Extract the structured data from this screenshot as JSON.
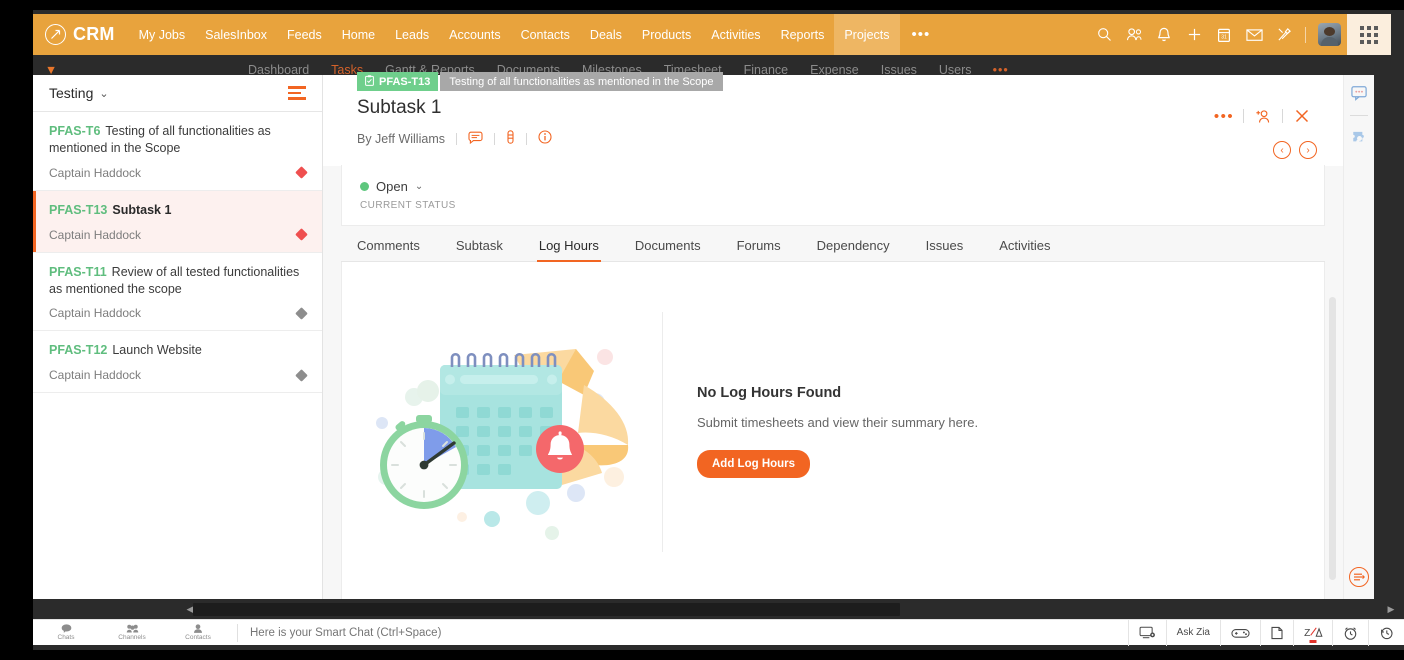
{
  "topnav": {
    "brand": "CRM",
    "brand_icon": "zoho-circle-icon",
    "items": [
      {
        "label": "My Jobs",
        "active": false
      },
      {
        "label": "SalesInbox",
        "active": false
      },
      {
        "label": "Feeds",
        "active": false
      },
      {
        "label": "Home",
        "active": false
      },
      {
        "label": "Leads",
        "active": false
      },
      {
        "label": "Accounts",
        "active": false
      },
      {
        "label": "Contacts",
        "active": false
      },
      {
        "label": "Deals",
        "active": false
      },
      {
        "label": "Products",
        "active": false
      },
      {
        "label": "Activities",
        "active": false
      },
      {
        "label": "Reports",
        "active": false
      },
      {
        "label": "Projects",
        "active": true
      }
    ],
    "more": "•••",
    "right_icons": [
      "search-icon",
      "users-icon",
      "bell-icon",
      "plus-icon",
      "calendar-icon",
      "mail-icon",
      "tools-icon"
    ],
    "avatar": "user-avatar",
    "launcher": "app-grid-icon",
    "accent": "#e8a33d",
    "active_bg": "#eeb663"
  },
  "subnav": {
    "items": [
      {
        "label": "Dashboard",
        "active": false
      },
      {
        "label": "Tasks",
        "active": true
      },
      {
        "label": "Gantt & Reports",
        "active": false
      },
      {
        "label": "Documents",
        "active": false
      },
      {
        "label": "Milestones",
        "active": false
      },
      {
        "label": "Timesheet",
        "active": false
      },
      {
        "label": "Finance",
        "active": false
      },
      {
        "label": "Expense",
        "active": false
      },
      {
        "label": "Issues",
        "active": false
      },
      {
        "label": "Users",
        "active": false
      }
    ],
    "more": "•••"
  },
  "breadcrumb": {
    "id": "PFAS-T13",
    "id_icon": "clipboard-icon",
    "title": "Testing of all functionalities as mentioned in the Scope",
    "id_color": "#6fcf8c",
    "title_color": "#a8a8a8"
  },
  "list_panel": {
    "title": "Testing",
    "caret": "⌄",
    "filter_icon": "filter-icon",
    "tasks": [
      {
        "key": "PFAS-T6",
        "title": "Testing of all functionalities as mentioned in the Scope",
        "owner": "Captain Haddock",
        "priority": "high",
        "selected": false
      },
      {
        "key": "PFAS-T13",
        "title": "Subtask 1",
        "owner": "Captain Haddock",
        "priority": "high",
        "selected": true
      },
      {
        "key": "PFAS-T11",
        "title": "Review of all tested functionalities as mentioned the scope",
        "owner": "Captain Haddock",
        "priority": "low",
        "selected": false
      },
      {
        "key": "PFAS-T12",
        "title": "Launch Website",
        "owner": "Captain Haddock",
        "priority": "low",
        "selected": false
      }
    ]
  },
  "detail": {
    "title": "Subtask 1",
    "author": "By Jeff Williams",
    "meta_icons": [
      "comment-icon",
      "attachment-icon",
      "info-icon"
    ],
    "actions": {
      "more": "•••",
      "more_icon": "more-options-icon",
      "assign_icon": "assign-user-icon",
      "close_icon": "close-icon",
      "prev": "‹",
      "next": "›"
    },
    "status": {
      "value": "Open",
      "caret": "⌄",
      "label": "CURRENT STATUS",
      "dot_color": "#5ec77e"
    },
    "tabs": [
      {
        "label": "Comments",
        "active": false
      },
      {
        "label": "Subtask",
        "active": false
      },
      {
        "label": "Log Hours",
        "active": true
      },
      {
        "label": "Documents",
        "active": false
      },
      {
        "label": "Forums",
        "active": false
      },
      {
        "label": "Dependency",
        "active": false
      },
      {
        "label": "Issues",
        "active": false
      },
      {
        "label": "Activities",
        "active": false
      }
    ],
    "empty_state": {
      "illustration": "calendar-timer-hourglass-illustration",
      "heading": "No Log Hours Found",
      "description": "Submit timesheets and view their summary here.",
      "button": "Add Log Hours",
      "button_color": "#f26522"
    }
  },
  "right_strip": {
    "icons": [
      "chat-bubble-icon",
      "puzzle-extension-icon"
    ],
    "bottom_icon": "collapse-panel-icon"
  },
  "chatbar": {
    "tabs": [
      {
        "label": "Chats",
        "icon": "chat-icon"
      },
      {
        "label": "Channels",
        "icon": "channels-icon"
      },
      {
        "label": "Contacts",
        "icon": "contacts-icon"
      }
    ],
    "placeholder": "Here is your Smart Chat (Ctrl+Space)",
    "right_items": [
      {
        "label": "",
        "icon": "screen-share-icon"
      },
      {
        "label": "Ask Zia",
        "icon": "ask-zia-text"
      },
      {
        "label": "",
        "icon": "game-controller-icon"
      },
      {
        "label": "",
        "icon": "notes-icon"
      },
      {
        "label": "",
        "icon": "zia-logo-icon",
        "badge": true
      },
      {
        "label": "",
        "icon": "alarm-clock-icon"
      },
      {
        "label": "",
        "icon": "history-clock-icon"
      }
    ]
  },
  "scrollbars": {
    "h_left_arrow": "◀",
    "h_right_arrow": "▶"
  }
}
